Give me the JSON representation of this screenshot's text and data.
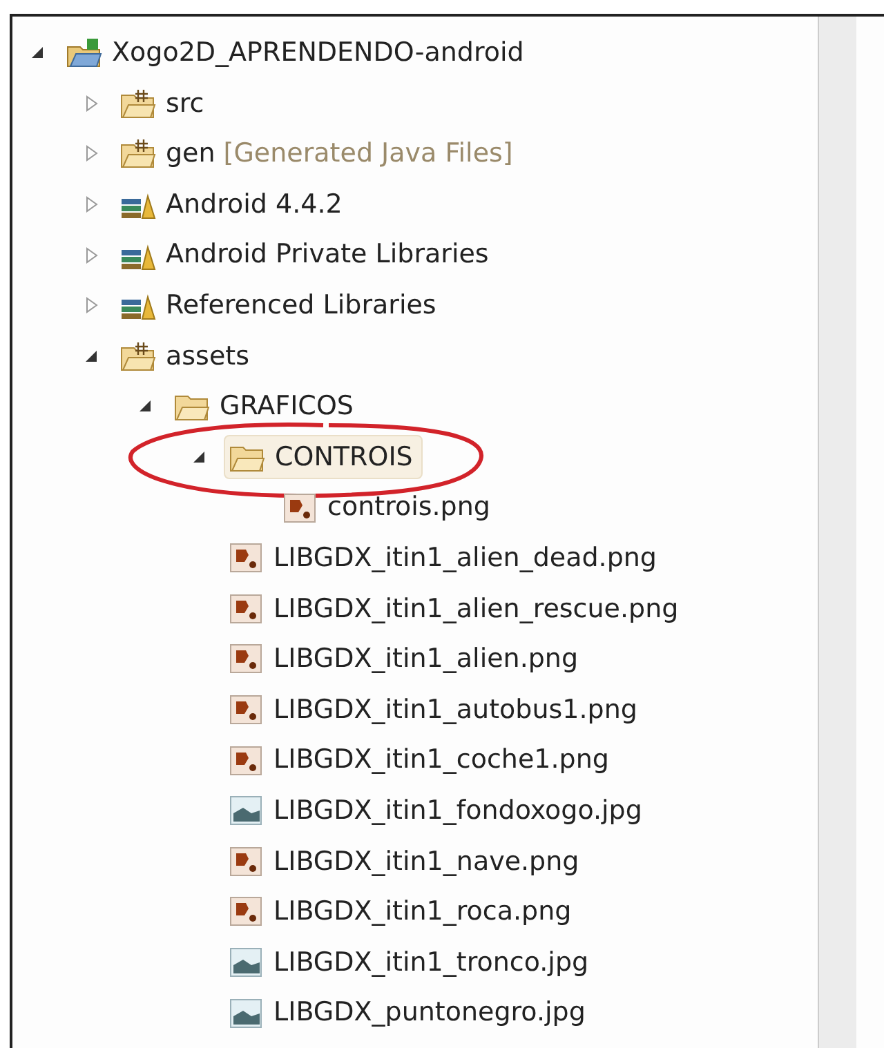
{
  "tree": [
    {
      "kind": "project",
      "label": "Xogo2D_APRENDENDO-android",
      "expanded": true,
      "selected": false,
      "circled": false,
      "children": [
        {
          "kind": "source_folder",
          "label": "src",
          "expanded": false,
          "selected": false,
          "circled": false
        },
        {
          "kind": "generated_folder",
          "label": "gen",
          "decoration": "[Generated Java Files]",
          "expanded": false,
          "selected": false,
          "circled": false
        },
        {
          "kind": "library",
          "label": "Android 4.4.2",
          "expanded": false,
          "selected": false,
          "circled": false
        },
        {
          "kind": "library",
          "label": "Android Private Libraries",
          "expanded": false,
          "selected": false,
          "circled": false
        },
        {
          "kind": "library",
          "label": "Referenced Libraries",
          "expanded": false,
          "selected": false,
          "circled": false
        },
        {
          "kind": "assets_folder",
          "label": "assets",
          "expanded": true,
          "selected": false,
          "circled": false,
          "children": [
            {
              "kind": "folder",
              "label": "GRAFICOS",
              "expanded": true,
              "selected": false,
              "circled": false,
              "children": [
                {
                  "kind": "folder",
                  "label": "CONTROIS",
                  "expanded": true,
                  "selected": true,
                  "circled": true,
                  "children": [
                    {
                      "kind": "png",
                      "label": "controis.png",
                      "selected": false,
                      "circled": false
                    }
                  ]
                },
                {
                  "kind": "png",
                  "label": "LIBGDX_itin1_alien_dead.png",
                  "selected": false,
                  "circled": false
                },
                {
                  "kind": "png",
                  "label": "LIBGDX_itin1_alien_rescue.png",
                  "selected": false,
                  "circled": false
                },
                {
                  "kind": "png",
                  "label": "LIBGDX_itin1_alien.png",
                  "selected": false,
                  "circled": false
                },
                {
                  "kind": "png",
                  "label": "LIBGDX_itin1_autobus1.png",
                  "selected": false,
                  "circled": false
                },
                {
                  "kind": "png",
                  "label": "LIBGDX_itin1_coche1.png",
                  "selected": false,
                  "circled": false
                },
                {
                  "kind": "jpg",
                  "label": "LIBGDX_itin1_fondoxogo.jpg",
                  "selected": false,
                  "circled": false
                },
                {
                  "kind": "png",
                  "label": "LIBGDX_itin1_nave.png",
                  "selected": false,
                  "circled": false
                },
                {
                  "kind": "png",
                  "label": "LIBGDX_itin1_roca.png",
                  "selected": false,
                  "circled": false
                },
                {
                  "kind": "jpg",
                  "label": "LIBGDX_itin1_tronco.jpg",
                  "selected": false,
                  "circled": false
                },
                {
                  "kind": "jpg",
                  "label": "LIBGDX_puntonegro.jpg",
                  "selected": false,
                  "circled": false
                }
              ]
            }
          ]
        }
      ]
    }
  ]
}
